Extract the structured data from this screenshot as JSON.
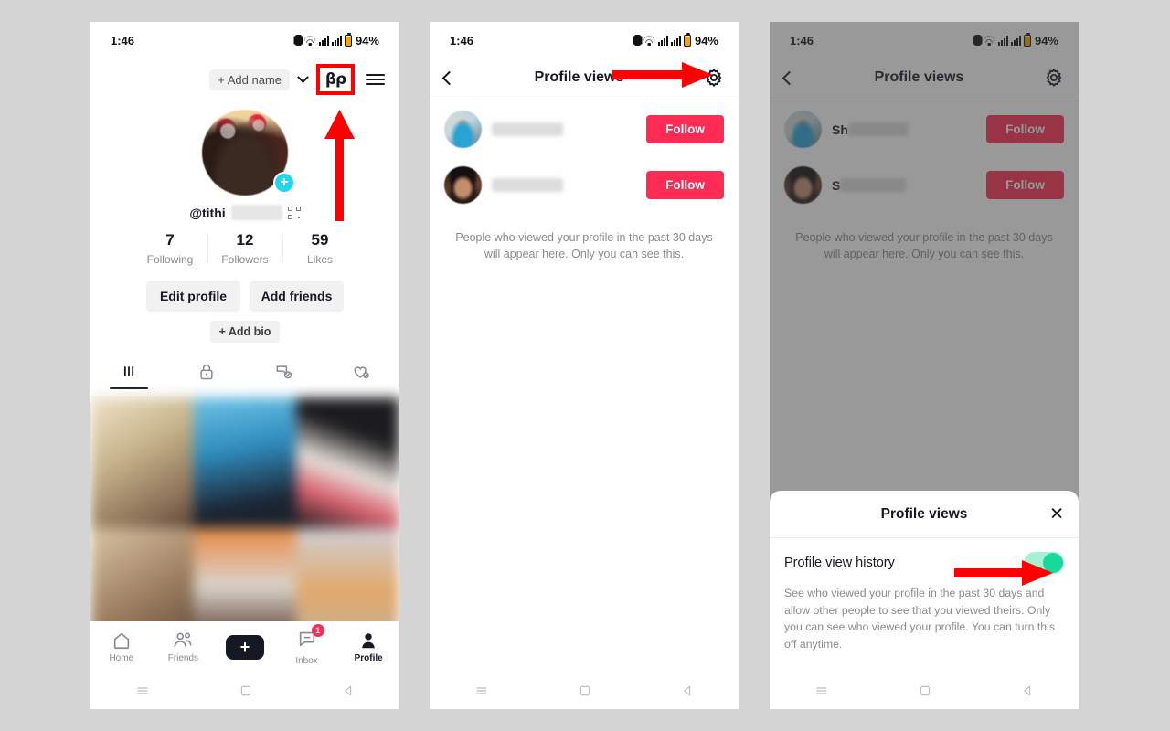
{
  "background_color": "#d4d4d4",
  "accent_color": "#fe2c55",
  "annotation_color": "#ff0000",
  "toggle_on_color": "#16d99a",
  "status_bar": {
    "time": "1:46",
    "battery_percent": "94%",
    "icons": [
      "vibrate-icon",
      "wifi-icon",
      "signal-icon",
      "signal-icon",
      "battery-icon"
    ]
  },
  "panel1": {
    "name_chip": "+ Add name",
    "footsteps_icon_label": "profile-views-footsteps-icon",
    "handle": "@tithi",
    "stats": [
      {
        "value": "7",
        "label": "Following"
      },
      {
        "value": "12",
        "label": "Followers"
      },
      {
        "value": "59",
        "label": "Likes"
      }
    ],
    "buttons": {
      "edit_profile": "Edit profile",
      "add_friends": "Add friends",
      "add_bio": "+ Add bio"
    },
    "tabs": [
      {
        "name": "posts-tab",
        "icon": "grid-icon",
        "active": true
      },
      {
        "name": "private-tab",
        "icon": "lock-icon",
        "active": false
      },
      {
        "name": "reposts-tab",
        "icon": "repost-icon",
        "active": false
      },
      {
        "name": "liked-tab",
        "icon": "heart-icon",
        "active": false
      }
    ],
    "bottom_nav": [
      {
        "label": "Home",
        "icon": "home-icon",
        "active": false
      },
      {
        "label": "Friends",
        "icon": "friends-icon",
        "active": false
      },
      {
        "label": "",
        "icon": "create-plus-icon",
        "active": false
      },
      {
        "label": "Inbox",
        "icon": "inbox-icon",
        "badge": "1",
        "active": false
      },
      {
        "label": "Profile",
        "icon": "person-icon",
        "active": true
      }
    ]
  },
  "panel2": {
    "title": "Profile views",
    "rows": [
      {
        "name": "",
        "follow_label": "Follow"
      },
      {
        "name": "",
        "follow_label": "Follow"
      }
    ],
    "note": "People who viewed your profile in the past 30 days will appear here. Only you can see this."
  },
  "panel3": {
    "title": "Profile views",
    "rows": [
      {
        "name": "Sh",
        "follow_label": "Follow"
      },
      {
        "name": "S",
        "follow_label": "Follow"
      }
    ],
    "note": "People who viewed your profile in the past 30 days will appear here. Only you can see this.",
    "sheet": {
      "title": "Profile views",
      "close_label": "✕",
      "setting_label": "Profile view history",
      "toggle_state": "on",
      "description": "See who viewed your profile in the past 30 days and allow other people to see that you viewed theirs. Only you can see who viewed your profile. You can turn this off anytime."
    }
  },
  "system_nav": {
    "recents": "recents-icon",
    "home": "home-square-icon",
    "back": "back-triangle-icon"
  }
}
